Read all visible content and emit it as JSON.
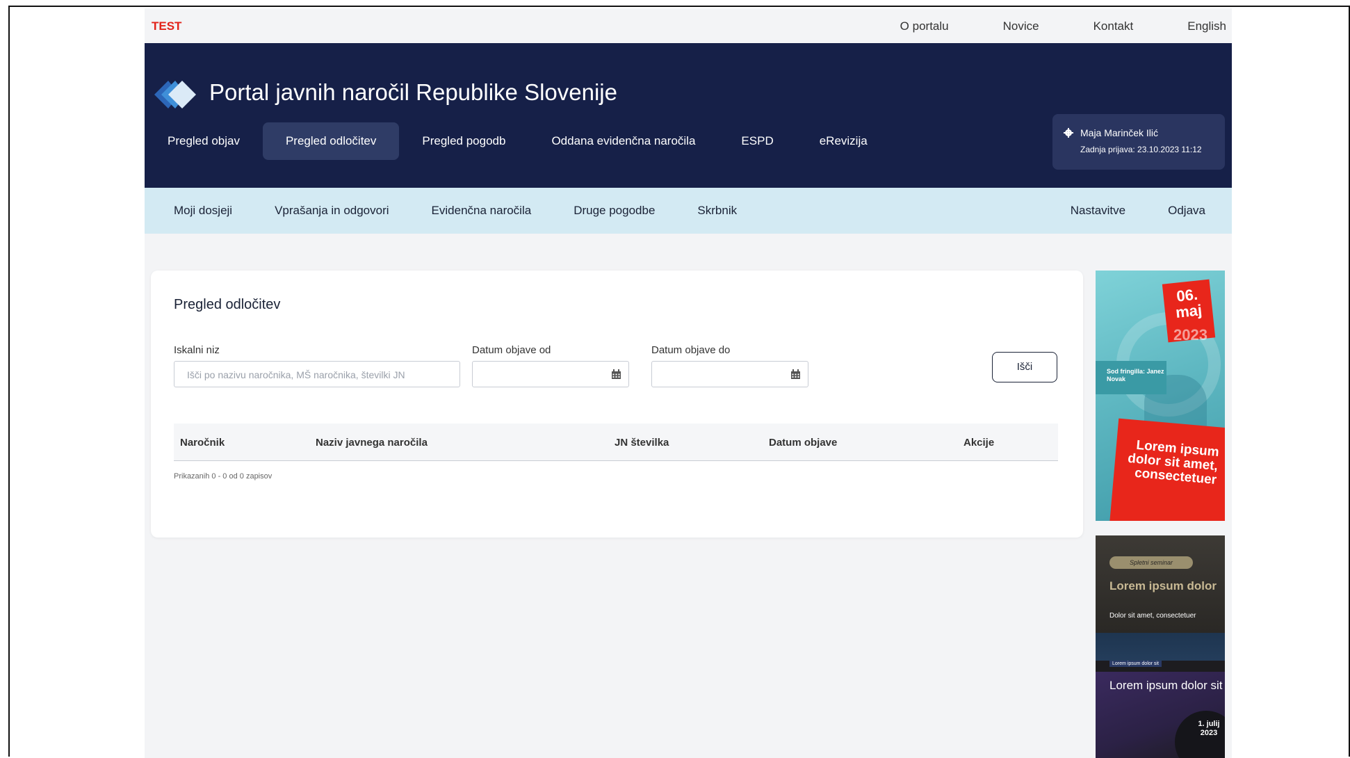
{
  "topbar": {
    "env_label": "TEST",
    "links": [
      "O portalu",
      "Novice",
      "Kontakt",
      "English"
    ]
  },
  "header": {
    "title": "Portal javnih naročil Republike Slovenije",
    "nav": [
      "Pregled objav",
      "Pregled odločitev",
      "Pregled pogodb",
      "Oddana evidenčna naročila",
      "ESPD",
      "eRevizija"
    ],
    "active_nav": "Pregled odločitev",
    "user": {
      "name": "Maja Marinček Ilić",
      "last_login": "Zadnja prijava: 23.10.2023 11:12"
    }
  },
  "subnav": {
    "left": [
      "Moji dosjeji",
      "Vprašanja in odgovori",
      "Evidenčna naročila",
      "Druge pogodbe",
      "Skrbnik"
    ],
    "right": [
      "Nastavitve",
      "Odjava"
    ]
  },
  "search": {
    "title": "Pregled odločitev",
    "query_label": "Iskalni niz",
    "query_placeholder": "Išči po nazivu naročnika, MŠ naročnika, številki JN",
    "query_value": "",
    "date_from_label": "Datum objave od",
    "date_from_value": "",
    "date_to_label": "Datum objave do",
    "date_to_value": "",
    "button": "Išči"
  },
  "table": {
    "columns": [
      "Naročnik",
      "Naziv javnega naročila",
      "JN številka",
      "Datum objave",
      "Akcije"
    ],
    "rows": [],
    "summary": "Prikazanih 0 - 0 od 0 zapisov"
  },
  "ads": {
    "ad1": {
      "date": "06. maj",
      "year": "2023",
      "seal": "Sod fringilla: Janez Novak",
      "headline": "Lorem ipsum dolor sit amet, consectetuer"
    },
    "ad2": {
      "pill": "Spletni seminar",
      "headline": "Lorem ipsum dolor",
      "sub": "Dolor sit amet, consectetuer",
      "chart_label": "Lorem ipsum dolor sit",
      "headline2": "Lorem ipsum dolor sit",
      "date": "1. julij 2023"
    }
  },
  "colors": {
    "header_bg": "#162048",
    "subnav_bg": "#d3eaf3",
    "test_label": "#e2231a",
    "ad_red": "#e8261b"
  }
}
